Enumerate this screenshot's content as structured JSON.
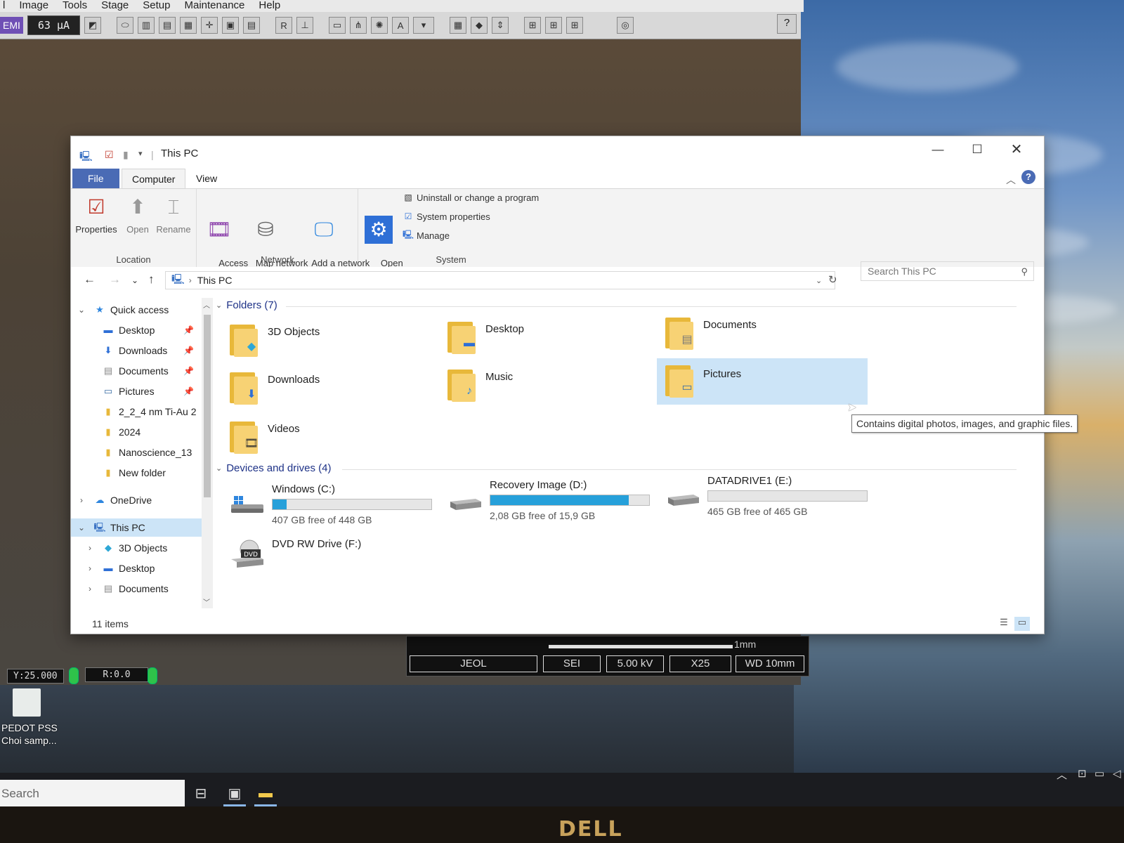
{
  "sem": {
    "menu": [
      "l",
      "Image",
      "Tools",
      "Stage",
      "Setup",
      "Maintenance",
      "Help"
    ],
    "emi_label": "EMI",
    "emission_current": "63 µA",
    "y_readout": "Y:25.000",
    "r_readout": "R:0.0",
    "info_bar": {
      "scale_label": "1mm",
      "maker": "JEOL",
      "detector": "SEI",
      "voltage": "5.00 kV",
      "magnification": "X25",
      "working_distance": "WD 10mm"
    }
  },
  "desktop": {
    "icon_label": "PEDOT PSS\nChoi samp..."
  },
  "taskbar": {
    "search_text": "Search",
    "icons": [
      "task-view-icon",
      "sem-app-icon",
      "file-explorer-icon"
    ]
  },
  "explorer": {
    "title": "This PC",
    "ribbon_tabs": [
      "File",
      "Computer",
      "View"
    ],
    "groups": {
      "location": {
        "label": "Location",
        "buttons": [
          "Properties",
          "Open",
          "Rename"
        ]
      },
      "network": {
        "label": "Network",
        "buttons": [
          "Access\nmedia ▾",
          "Map network\ndrive ▾",
          "Add a network\nlocation"
        ]
      },
      "system": {
        "label": "System",
        "open_settings": "Open\nSettings",
        "links": [
          "Uninstall or change a program",
          "System properties",
          "Manage"
        ]
      }
    },
    "address": {
      "path": "This PC",
      "search_placeholder": "Search This PC"
    },
    "nav_pane": {
      "quick_access": "Quick access",
      "pinned": [
        "Desktop",
        "Downloads",
        "Documents",
        "Pictures"
      ],
      "recent": [
        "2_2_4 nm Ti-Au 2",
        "2024",
        "Nanoscience_13",
        "New folder"
      ],
      "onedrive": "OneDrive",
      "this_pc": "This PC",
      "this_pc_children": [
        "3D Objects",
        "Desktop",
        "Documents"
      ]
    },
    "folders_header": "Folders (7)",
    "folders": [
      "3D Objects",
      "Desktop",
      "Documents",
      "Downloads",
      "Music",
      "Pictures",
      "Videos"
    ],
    "drives_header": "Devices and drives (4)",
    "drives": [
      {
        "name": "Windows (C:)",
        "free": "407 GB free of 448 GB",
        "used_fraction": 0.09
      },
      {
        "name": "Recovery Image (D:)",
        "free": "2,08 GB free of 15,9 GB",
        "used_fraction": 0.87
      },
      {
        "name": "DATADRIVE1 (E:)",
        "free": "465 GB free of 465 GB",
        "used_fraction": 0.0
      },
      {
        "name": "DVD RW Drive (F:)"
      }
    ],
    "dvd_label": "DVD",
    "tooltip": "Contains digital photos, images, and graphic files.",
    "status": "11 items"
  },
  "monitor_brand": "DELL"
}
